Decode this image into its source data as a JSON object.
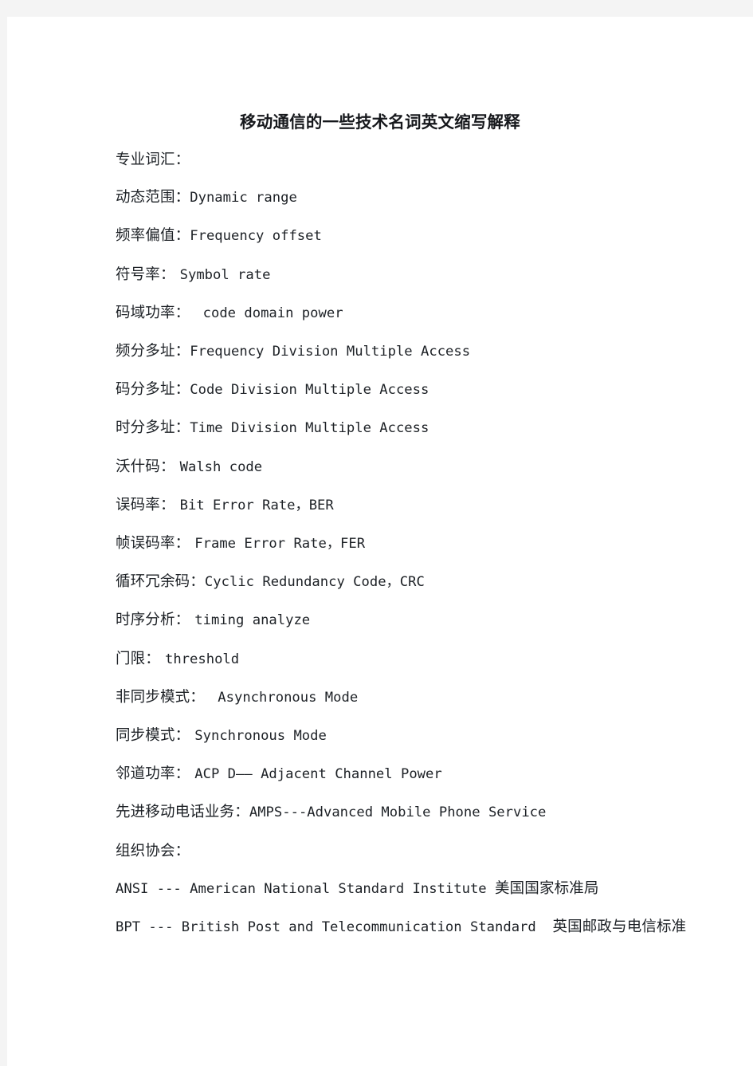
{
  "document": {
    "title": "移动通信的一些技术名词英文缩写解释",
    "background_color": "#f4f4f4",
    "page_color": "#ffffff",
    "text_color": "#1d2126",
    "lines": [
      {
        "cn": "专业词汇：",
        "en": ""
      },
      {
        "cn": "动态范围：",
        "en": "Dynamic range"
      },
      {
        "cn": "频率偏值：",
        "en": "Frequency offset"
      },
      {
        "cn": "符号率： ",
        "en": "Symbol rate"
      },
      {
        "cn": "码域功率： ",
        "en": " code domain power"
      },
      {
        "cn": "频分多址：",
        "en": "Frequency Division Multiple Access"
      },
      {
        "cn": "码分多址：",
        "en": "Code Division Multiple Access"
      },
      {
        "cn": "时分多址：",
        "en": "Time Division Multiple Access"
      },
      {
        "cn": "沃什码： ",
        "en": "Walsh code"
      },
      {
        "cn": "误码率： ",
        "en": "Bit Error Rate，BER"
      },
      {
        "cn": "帧误码率： ",
        "en": "Frame Error Rate，FER"
      },
      {
        "cn": "循环冗余码：",
        "en": "Cyclic Redundancy Code，CRC"
      },
      {
        "cn": "时序分析： ",
        "en": "timing analyze"
      },
      {
        "cn": "门限： ",
        "en": "threshold"
      },
      {
        "cn": "非同步模式： ",
        "en": " Asynchronous Mode"
      },
      {
        "cn": "同步模式： ",
        "en": "Synchronous Mode"
      },
      {
        "cn": "邻道功率： ",
        "en": "ACP D—— Adjacent Channel Power"
      },
      {
        "cn": "先进移动电话业务：",
        "en": "AMPS---Advanced Mobile Phone Service"
      },
      {
        "cn": "组织协会：",
        "en": ""
      },
      {
        "cn": "",
        "en": "ANSI --- American National Standard Institute ",
        "cn_tail": "美国国家标准局"
      },
      {
        "cn": "",
        "en": "BPT --- British Post and Telecommunication Standard  ",
        "cn_tail": "英国邮政与电信标准"
      }
    ]
  }
}
